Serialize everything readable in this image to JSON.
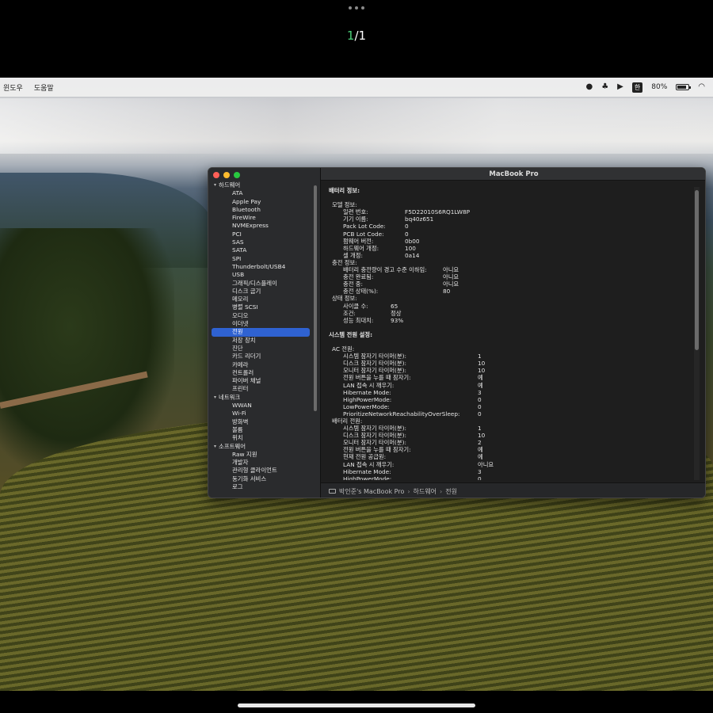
{
  "viewer": {
    "current": "1",
    "total": "/1"
  },
  "menubar": {
    "items": [
      "윈도우",
      "도움말"
    ],
    "input_source": "한",
    "battery_percent": "80%",
    "battery_level": 0.8
  },
  "window": {
    "title": "MacBook Pro",
    "sidebar": [
      {
        "type": "section",
        "label": "하드웨어"
      },
      {
        "type": "item",
        "label": "ATA"
      },
      {
        "type": "item",
        "label": "Apple Pay"
      },
      {
        "type": "item",
        "label": "Bluetooth"
      },
      {
        "type": "item",
        "label": "FireWire"
      },
      {
        "type": "item",
        "label": "NVMExpress"
      },
      {
        "type": "item",
        "label": "PCI"
      },
      {
        "type": "item",
        "label": "SAS"
      },
      {
        "type": "item",
        "label": "SATA"
      },
      {
        "type": "item",
        "label": "SPI"
      },
      {
        "type": "item",
        "label": "Thunderbolt/USB4"
      },
      {
        "type": "item",
        "label": "USB"
      },
      {
        "type": "item",
        "label": "그래픽/디스플레이"
      },
      {
        "type": "item",
        "label": "디스크 굽기"
      },
      {
        "type": "item",
        "label": "메모리"
      },
      {
        "type": "item",
        "label": "병렬 SCSI"
      },
      {
        "type": "item",
        "label": "오디오"
      },
      {
        "type": "item",
        "label": "이더넷"
      },
      {
        "type": "item",
        "label": "전원",
        "selected": true
      },
      {
        "type": "item",
        "label": "저장 장치"
      },
      {
        "type": "item",
        "label": "진단"
      },
      {
        "type": "item",
        "label": "카드 리더기"
      },
      {
        "type": "item",
        "label": "카메라"
      },
      {
        "type": "item",
        "label": "컨트롤러"
      },
      {
        "type": "item",
        "label": "파이버 채널"
      },
      {
        "type": "item",
        "label": "프린터"
      },
      {
        "type": "section",
        "label": "네트워크"
      },
      {
        "type": "item",
        "label": "WWAN"
      },
      {
        "type": "item",
        "label": "Wi-Fi"
      },
      {
        "type": "item",
        "label": "방화벽"
      },
      {
        "type": "item",
        "label": "볼륨"
      },
      {
        "type": "item",
        "label": "위치"
      },
      {
        "type": "section",
        "label": "소프트웨어"
      },
      {
        "type": "item",
        "label": "Raw 지원"
      },
      {
        "type": "item",
        "label": "개발자"
      },
      {
        "type": "item",
        "label": "관리형 클라이언트"
      },
      {
        "type": "item",
        "label": "동기화 서비스"
      },
      {
        "type": "item",
        "label": "로그"
      }
    ],
    "content": [
      {
        "type": "header",
        "text": "배터리 정보:",
        "indent": 0
      },
      {
        "type": "gap"
      },
      {
        "type": "header",
        "text": "모델 정보:",
        "indent": 1,
        "plain": true
      },
      {
        "type": "kv",
        "k": "일련 번호:",
        "v": "F5D22010S6RQ1LW8P",
        "indent": 2,
        "col": 78
      },
      {
        "type": "kv",
        "k": "기기 이름:",
        "v": "bq40z651",
        "indent": 2,
        "col": 78
      },
      {
        "type": "kv",
        "k": "Pack Lot Code:",
        "v": "0",
        "indent": 2,
        "col": 78
      },
      {
        "type": "kv",
        "k": "PCB Lot Code:",
        "v": "0",
        "indent": 2,
        "col": 78
      },
      {
        "type": "kv",
        "k": "펌웨어 버전:",
        "v": "0b00",
        "indent": 2,
        "col": 78
      },
      {
        "type": "kv",
        "k": "하드웨어 개정:",
        "v": "100",
        "indent": 2,
        "col": 78
      },
      {
        "type": "kv",
        "k": "셀 개정:",
        "v": "0a14",
        "indent": 2,
        "col": 78
      },
      {
        "type": "header",
        "text": "충전 정보:",
        "indent": 1,
        "plain": true
      },
      {
        "type": "kv",
        "k": "배터리 충전량이 경고 수준 이하임:",
        "v": "아니요",
        "indent": 2,
        "col": 126
      },
      {
        "type": "kv",
        "k": "충전 완료됨:",
        "v": "아니요",
        "indent": 2,
        "col": 126
      },
      {
        "type": "kv",
        "k": "충전 중:",
        "v": "아니요",
        "indent": 2,
        "col": 126
      },
      {
        "type": "kv",
        "k": "충전 상태(%):",
        "v": "80",
        "indent": 2,
        "col": 126
      },
      {
        "type": "header",
        "text": "상태 정보:",
        "indent": 1,
        "plain": true
      },
      {
        "type": "kv",
        "k": "사이클 수:",
        "v": "65",
        "indent": 2,
        "col": 60
      },
      {
        "type": "kv",
        "k": "조건:",
        "v": "정상",
        "indent": 2,
        "col": 60
      },
      {
        "type": "kv",
        "k": "성능 최대치:",
        "v": "93%",
        "indent": 2,
        "col": 60
      },
      {
        "type": "gap"
      },
      {
        "type": "header",
        "text": "시스템 전원 설정:",
        "indent": 0
      },
      {
        "type": "gap"
      },
      {
        "type": "header",
        "text": "AC 전원:",
        "indent": 1,
        "plain": true
      },
      {
        "type": "kv",
        "k": "시스템 잠자기 타이머(분):",
        "v": "1",
        "indent": 2,
        "col": 170
      },
      {
        "type": "kv",
        "k": "디스크 잠자기 타이머(분):",
        "v": "10",
        "indent": 2,
        "col": 170
      },
      {
        "type": "kv",
        "k": "모니터 잠자기 타이머(분):",
        "v": "10",
        "indent": 2,
        "col": 170
      },
      {
        "type": "kv",
        "k": "전원 버튼을 누를 때 잠자기:",
        "v": "예",
        "indent": 2,
        "col": 170
      },
      {
        "type": "kv",
        "k": "LAN 접속 시 깨우기:",
        "v": "예",
        "indent": 2,
        "col": 170
      },
      {
        "type": "kv",
        "k": "Hibernate Mode:",
        "v": "3",
        "indent": 2,
        "col": 170
      },
      {
        "type": "kv",
        "k": "HighPowerMode:",
        "v": "0",
        "indent": 2,
        "col": 170
      },
      {
        "type": "kv",
        "k": "LowPowerMode:",
        "v": "0",
        "indent": 2,
        "col": 170
      },
      {
        "type": "kv",
        "k": "PrioritizeNetworkReachabilityOverSleep:",
        "v": "0",
        "indent": 2,
        "col": 170
      },
      {
        "type": "header",
        "text": "배터리 전원:",
        "indent": 1,
        "plain": true
      },
      {
        "type": "kv",
        "k": "시스템 잠자기 타이머(분):",
        "v": "1",
        "indent": 2,
        "col": 170
      },
      {
        "type": "kv",
        "k": "디스크 잠자기 타이머(분):",
        "v": "10",
        "indent": 2,
        "col": 170
      },
      {
        "type": "kv",
        "k": "모니터 잠자기 타이머(분):",
        "v": "2",
        "indent": 2,
        "col": 170
      },
      {
        "type": "kv",
        "k": "전원 버튼을 누를 때 잠자기:",
        "v": "예",
        "indent": 2,
        "col": 170
      },
      {
        "type": "kv",
        "k": "현재 전원 공급원:",
        "v": "예",
        "indent": 2,
        "col": 170
      },
      {
        "type": "kv",
        "k": "LAN 접속 시 깨우기:",
        "v": "아니요",
        "indent": 2,
        "col": 170
      },
      {
        "type": "kv",
        "k": "Hibernate Mode:",
        "v": "3",
        "indent": 2,
        "col": 170
      },
      {
        "type": "kv",
        "k": "HighPowerMode:",
        "v": "0",
        "indent": 2,
        "col": 170
      }
    ],
    "pathbar": {
      "computer": "박인준's MacBook Pro",
      "section": "하드웨어",
      "item": "전원"
    }
  }
}
